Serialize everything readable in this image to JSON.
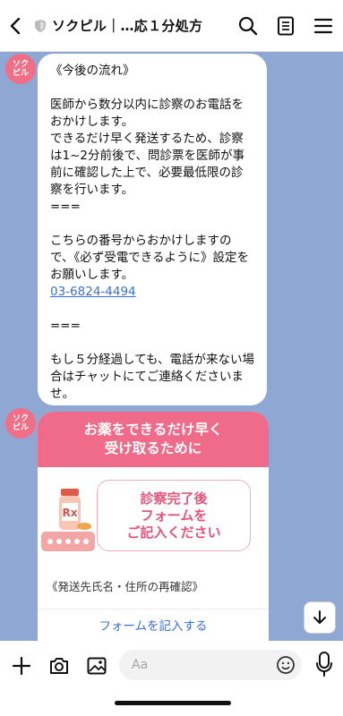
{
  "header": {
    "title": "ソクピル｜…応１分処方"
  },
  "avatar_label": "ソク\nピル",
  "message": {
    "lines": [
      "《今後の流れ》",
      "",
      "医師から数分以内に診察のお電話をおかけします。",
      "できるだけ早く発送するため、診察は1~2分前後で、問診票を医師が事前に確認した上で、必要最低限の診察を行います。",
      "===",
      "",
      "こちらの番号からおかけしますので、《必ず受電できるように》設定をお願いします。"
    ],
    "phone": "03-6824-4494",
    "lines_after": [
      "",
      "===",
      "",
      "もし５分経過しても、電話が来ない場合はチャットにてご連絡くださいませ。"
    ]
  },
  "card": {
    "header_line1": "お薬をできるだけ早く",
    "header_line2": "受け取るために",
    "badge_line1": "診察完了後",
    "badge_line2": "フォームを",
    "badge_line3": "ご記入ください",
    "description": "《発送先氏名・住所の再確認》",
    "button_label": "フォームを記入する"
  },
  "input": {
    "placeholder": "Aa"
  },
  "colors": {
    "chat_bg": "#8fa8d3",
    "accent_pink": "#f06a8a",
    "link_blue": "#3b6fd1"
  }
}
